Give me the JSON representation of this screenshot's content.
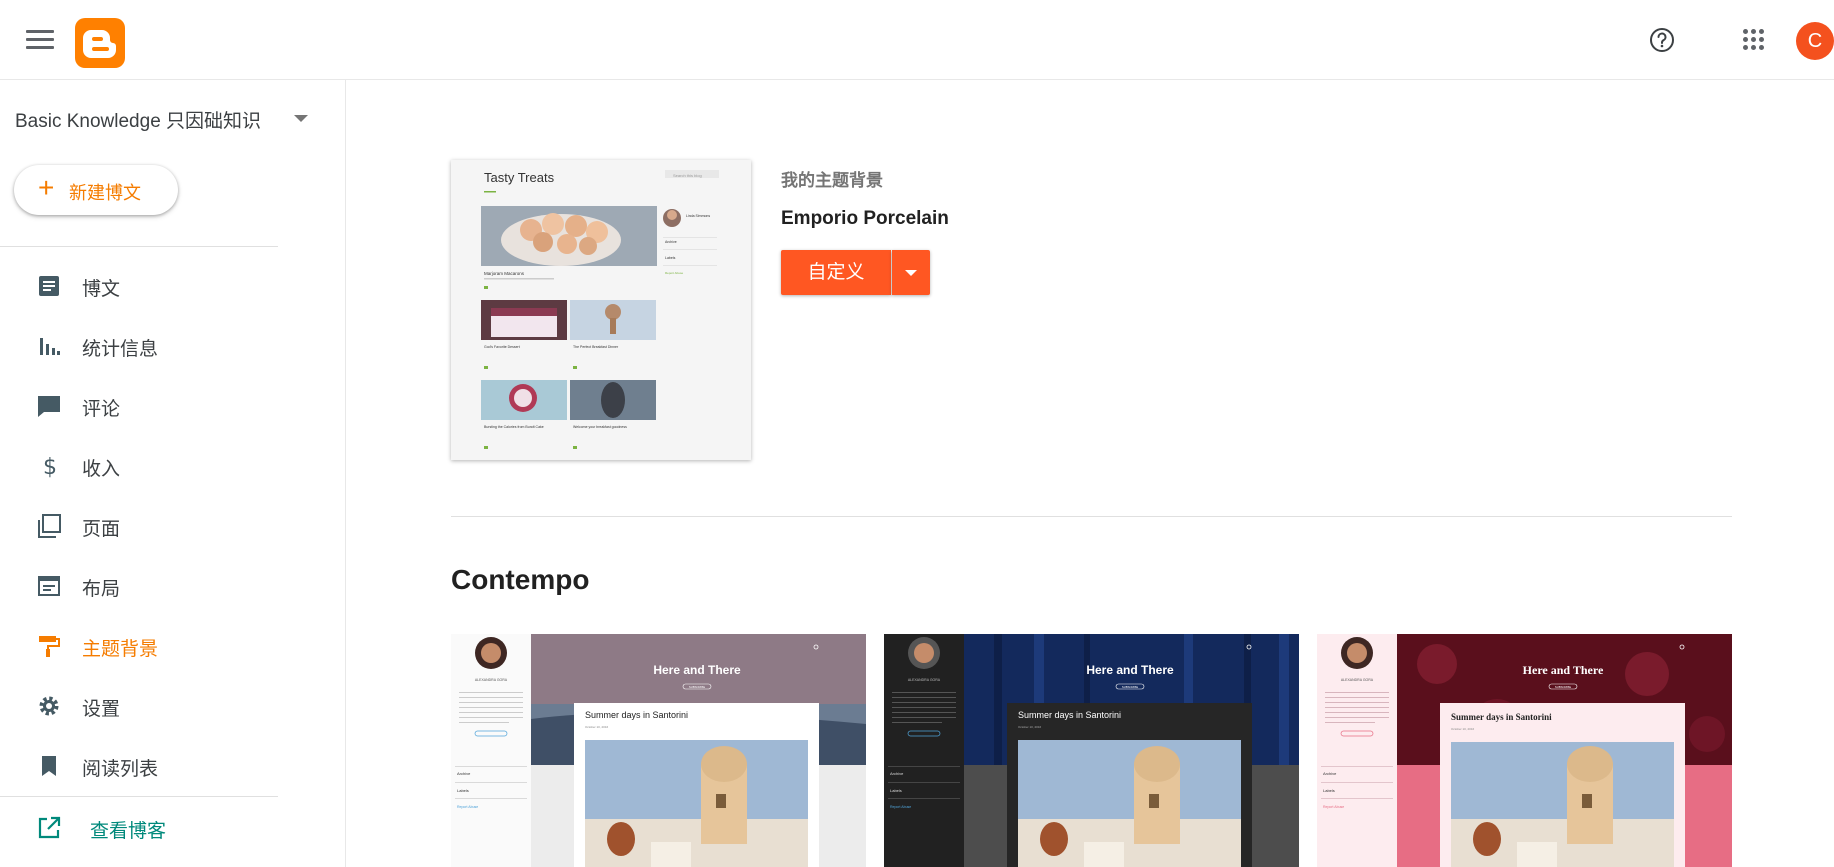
{
  "topbar": {
    "menu_icon": "menu-icon",
    "logo_icon": "blogger-logo",
    "help_icon": "help-icon",
    "apps_icon": "apps-grid-icon",
    "avatar_letter": "C",
    "avatar_color": "#f4511e"
  },
  "sidebar": {
    "blog_name": "Basic Knowledge 只因础知识",
    "new_post_label": "新建博文",
    "items": [
      {
        "label": "博文",
        "icon": "posts-icon"
      },
      {
        "label": "统计信息",
        "icon": "stats-icon"
      },
      {
        "label": "评论",
        "icon": "comments-icon"
      },
      {
        "label": "收入",
        "icon": "dollar-icon"
      },
      {
        "label": "页面",
        "icon": "pages-icon"
      },
      {
        "label": "布局",
        "icon": "layout-icon"
      },
      {
        "label": "主题背景",
        "icon": "paint-roller-icon",
        "active": true
      },
      {
        "label": "设置",
        "icon": "gear-icon"
      },
      {
        "label": "阅读列表",
        "icon": "bookmark-icon"
      }
    ],
    "view_blog_label": "查看博客"
  },
  "main": {
    "current_theme": {
      "label": "我的主题背景",
      "name": "Emporio Porcelain",
      "customize_label": "自定义",
      "thumb": {
        "title": "Tasty Treats",
        "search_placeholder": "Search this blog",
        "profile_name": "Linda Simmons",
        "sidebar_links": [
          "Archive",
          "Labels"
        ],
        "report_abuse": "Report Abuse",
        "posts": [
          "Marjoram Macarons",
          "God's Favorite Dessert",
          "The Perfect Breakfast Dinner",
          "Bursting the Calories from Bundt Cake",
          "Welcome your breakfast goodness"
        ]
      }
    },
    "section_title": "Contempo",
    "themes": [
      {
        "blog_title": "Here and There",
        "subscribe": "SUBSCRIBE",
        "post_title": "Summer days in Santorini",
        "post_date": "October 10, 2016",
        "profile_name": "ALEXANDRA GORA",
        "sidebar_links": [
          "Archive",
          "Labels"
        ],
        "report_abuse": "Report Abuse",
        "variant": "light"
      },
      {
        "blog_title": "Here and There",
        "subscribe": "SUBSCRIBE",
        "post_title": "Summer days in Santorini",
        "post_date": "October 10, 2016",
        "profile_name": "ALEXANDRA GORA",
        "sidebar_links": [
          "Archive",
          "Labels"
        ],
        "report_abuse": "Report Abuse",
        "variant": "dark"
      },
      {
        "blog_title": "Here and There",
        "subscribe": "SUBSCRIBE",
        "post_title": "Summer days in Santorini",
        "post_date": "October 10, 2016",
        "profile_name": "ALEXANDRA GORA",
        "sidebar_links": [
          "Archive",
          "Labels"
        ],
        "report_abuse": "Report Abuse",
        "variant": "pink"
      }
    ]
  },
  "colors": {
    "accent": "#f57c00",
    "customize": "#ff5722",
    "view_blog": "#00897b"
  }
}
